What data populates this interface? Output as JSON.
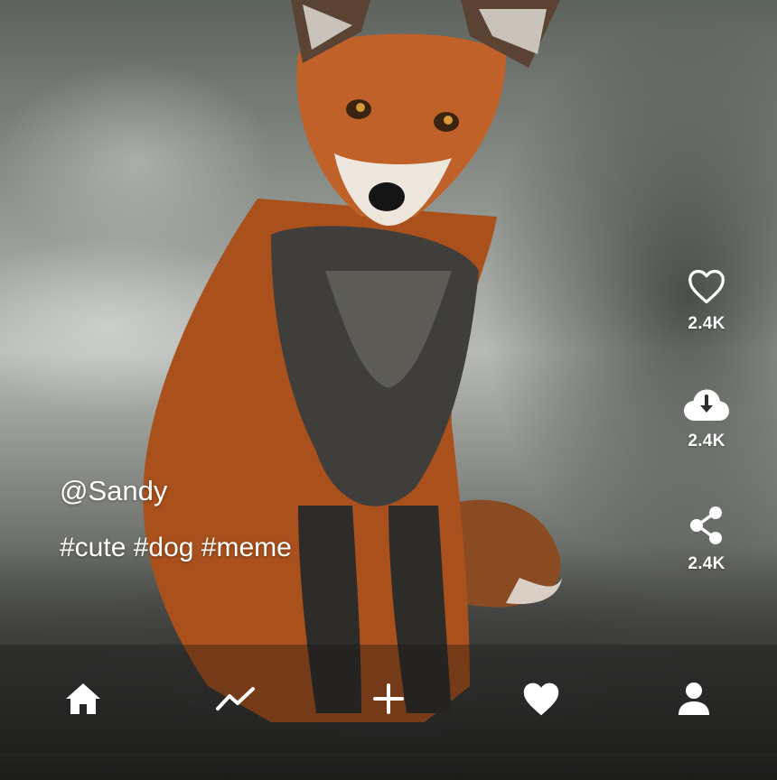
{
  "post": {
    "username": "@Sandy",
    "hashtags": "#cute #dog #meme"
  },
  "actions": [
    {
      "name": "like",
      "icon": "heart-outline-icon",
      "count": "2.4K"
    },
    {
      "name": "download",
      "icon": "cloud-download-icon",
      "count": "2.4K"
    },
    {
      "name": "share",
      "icon": "share-icon",
      "count": "2.4K"
    }
  ],
  "nav": [
    {
      "name": "home",
      "icon": "home-icon"
    },
    {
      "name": "trending",
      "icon": "trending-icon"
    },
    {
      "name": "create",
      "icon": "plus-icon"
    },
    {
      "name": "favorites",
      "icon": "heart-filled-icon"
    },
    {
      "name": "profile",
      "icon": "user-icon"
    }
  ],
  "colors": {
    "foreground": "#ffffff",
    "fox_fur": "#b4541f",
    "fox_dark": "#3b3a37"
  }
}
